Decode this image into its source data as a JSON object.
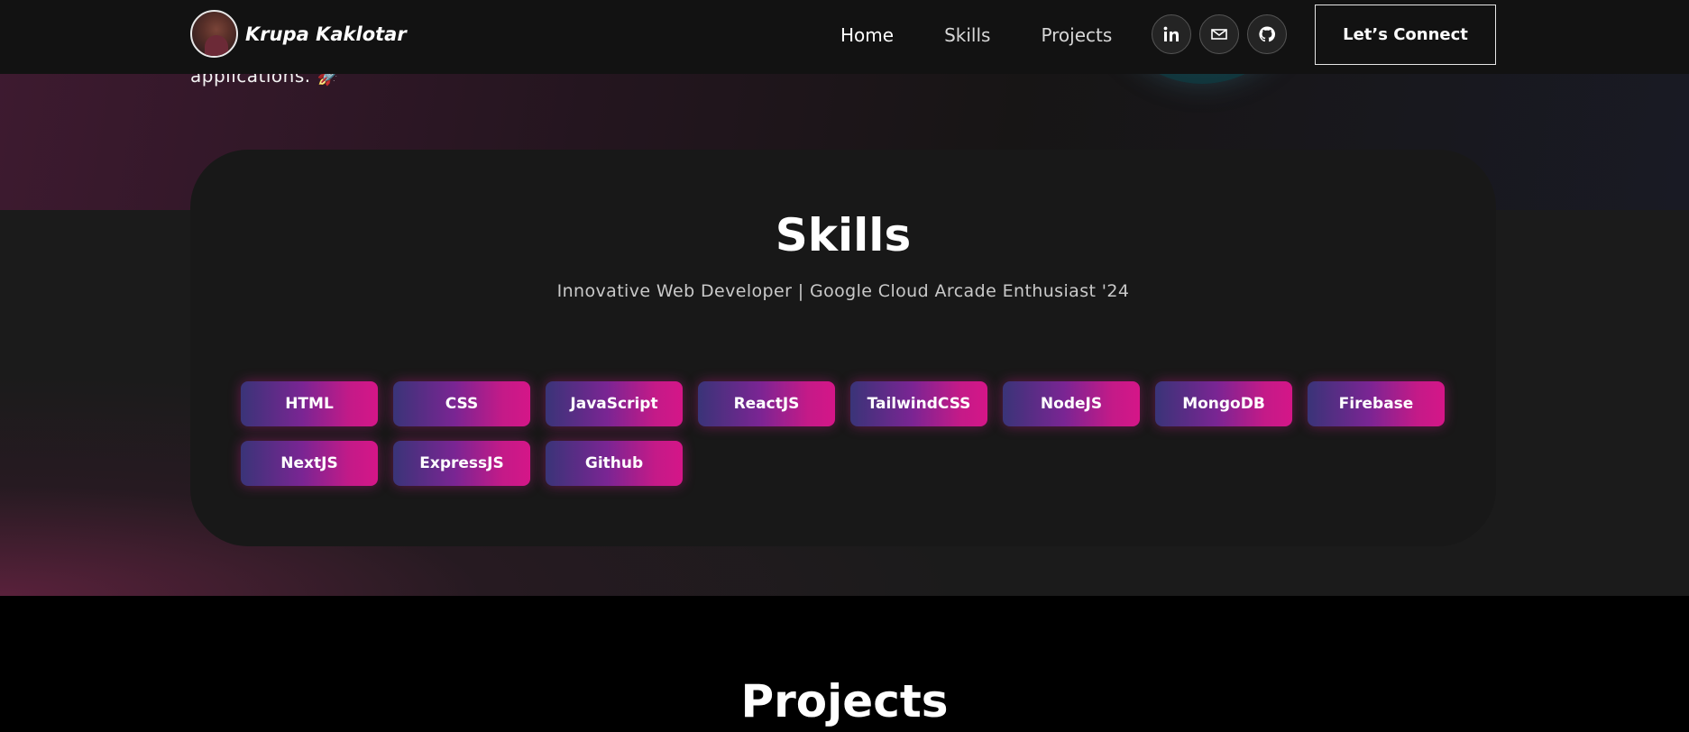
{
  "hero": {
    "tagline": "applications. 🚀"
  },
  "navbar": {
    "brand_name": "Krupa Kaklotar",
    "links": [
      {
        "label": "Home",
        "active": true
      },
      {
        "label": "Skills",
        "active": false
      },
      {
        "label": "Projects",
        "active": false
      }
    ],
    "social": [
      {
        "icon": "linkedin-icon"
      },
      {
        "icon": "mail-icon"
      },
      {
        "icon": "github-icon"
      }
    ],
    "connect_label": "Let’s Connect"
  },
  "skills": {
    "title": "Skills",
    "subtitle": "Innovative Web Developer | Google Cloud Arcade Enthusiast '24",
    "items": [
      "HTML",
      "CSS",
      "JavaScript",
      "ReactJS",
      "TailwindCSS",
      "NodeJS",
      "MongoDB",
      "Firebase",
      "NextJS",
      "ExpressJS",
      "Github"
    ]
  },
  "projects": {
    "title": "Projects"
  },
  "colors": {
    "navbar_bg": "#121212",
    "chip_start": "#3a3478",
    "chip_end": "#d51688",
    "card_bg": "#181818"
  }
}
